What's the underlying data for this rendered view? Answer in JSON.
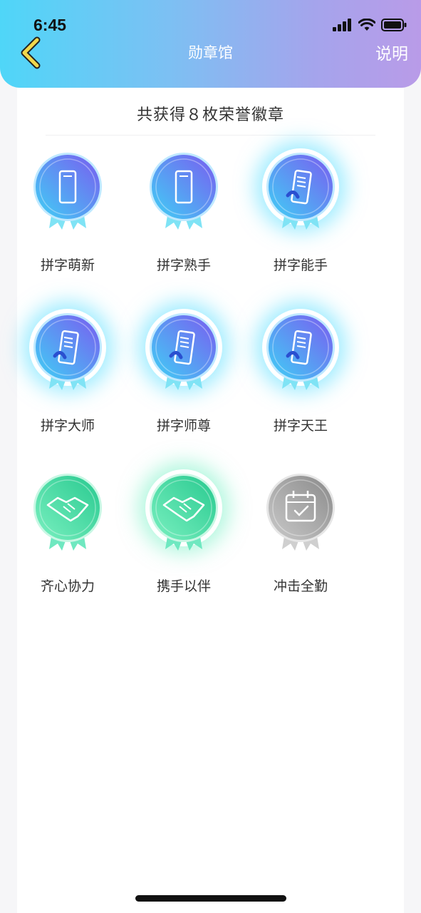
{
  "status_bar": {
    "time": "6:45"
  },
  "header": {
    "title": "勋章馆",
    "help_label": "说明"
  },
  "summary": {
    "text": "共获得８枚荣誉徽章"
  },
  "badges": [
    {
      "label": "拼字萌新",
      "theme": "blue",
      "icon": "phone-icon",
      "glow": false,
      "earned": true
    },
    {
      "label": "拼字熟手",
      "theme": "blue",
      "icon": "phone-icon",
      "glow": false,
      "earned": true
    },
    {
      "label": "拼字能手",
      "theme": "blue",
      "icon": "phone-writing-icon",
      "glow": true,
      "earned": true
    },
    {
      "label": "拼字大师",
      "theme": "blue",
      "icon": "phone-writing-icon",
      "glow": true,
      "earned": true
    },
    {
      "label": "拼字师尊",
      "theme": "blue",
      "icon": "phone-writing-icon",
      "glow": true,
      "earned": true
    },
    {
      "label": "拼字天王",
      "theme": "blue",
      "icon": "phone-writing-icon",
      "glow": true,
      "earned": true
    },
    {
      "label": "齐心协力",
      "theme": "green",
      "icon": "handshake-icon",
      "glow": false,
      "earned": true
    },
    {
      "label": "携手以伴",
      "theme": "green",
      "icon": "handshake-icon",
      "glow": true,
      "earned": true
    },
    {
      "label": "冲击全勤",
      "theme": "gray",
      "icon": "calendar-check-icon",
      "glow": false,
      "earned": false
    }
  ],
  "colors": {
    "blue_medal": "#5d7ff2",
    "green_medal": "#3fd9a3",
    "gray_medal": "#9a9a9a",
    "header_start": "#4fd6f8",
    "header_end": "#b99be8"
  }
}
